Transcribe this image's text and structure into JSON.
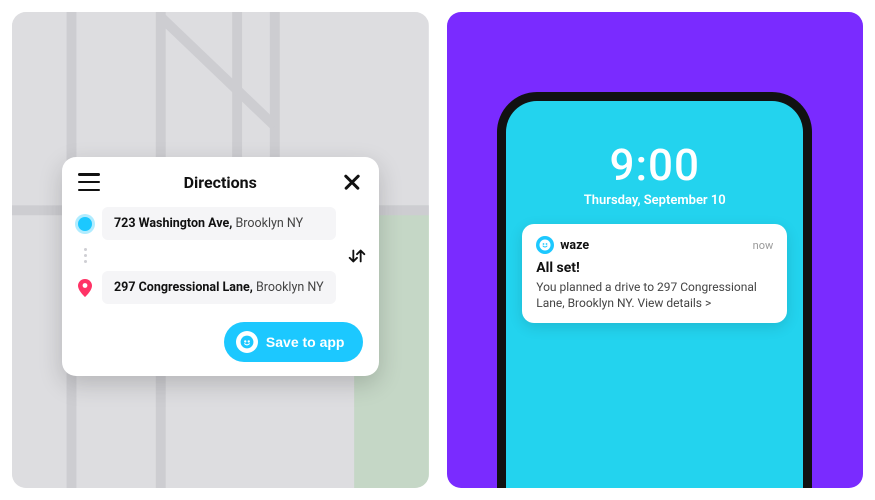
{
  "directions": {
    "title": "Directions",
    "origin": {
      "street": "723 Washington Ave,",
      "city": "Brooklyn NY"
    },
    "destination": {
      "street": "297 Congressional Lane,",
      "city": "Brooklyn NY"
    },
    "save_btn_label": "Save to app"
  },
  "phone": {
    "clock": "9:00",
    "date": "Thursday, September 10"
  },
  "notification": {
    "app_name": "waze",
    "time_label": "now",
    "title": "All set!",
    "body": "You planned a drive to 297 Congressional Lane, Brooklyn NY. View details >"
  },
  "colors": {
    "accent": "#1cc8ff",
    "purple": "#7a2bff",
    "phone_bg": "#23d3ee"
  }
}
